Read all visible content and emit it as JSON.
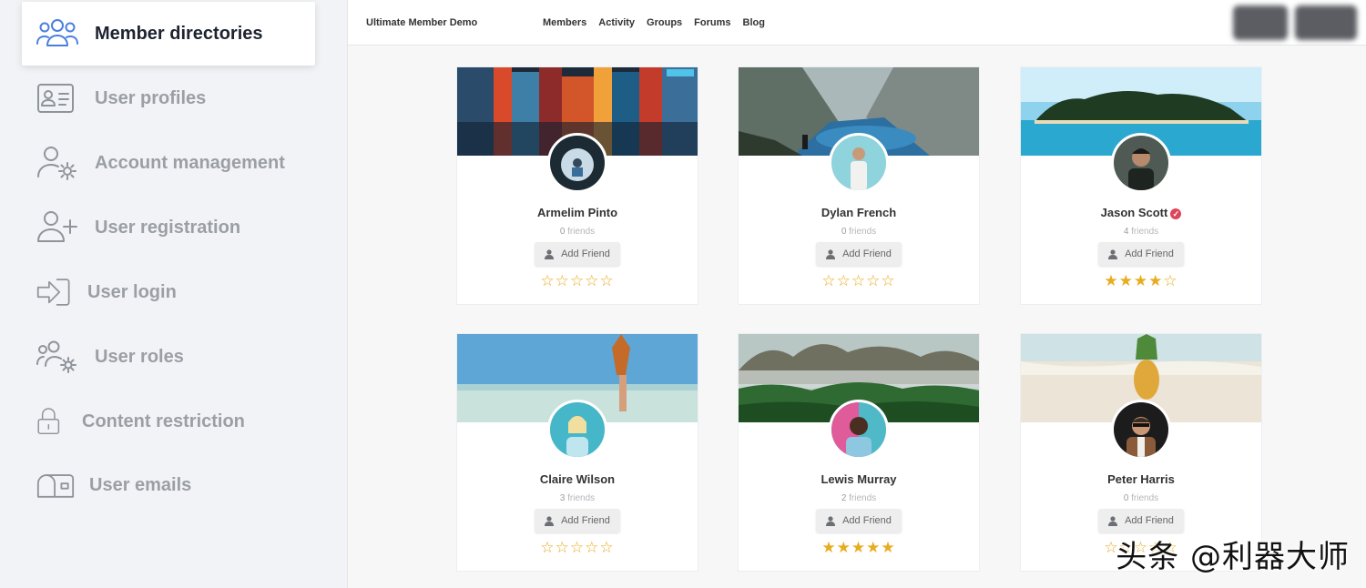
{
  "menu": {
    "items": [
      {
        "label": "Member directories",
        "icon": "users-icon",
        "active": true
      },
      {
        "label": "User profiles",
        "icon": "id-card-icon",
        "active": false
      },
      {
        "label": "Account management",
        "icon": "user-gear-icon",
        "active": false
      },
      {
        "label": "User registration",
        "icon": "user-plus-icon",
        "active": false
      },
      {
        "label": "User login",
        "icon": "login-arrow-icon",
        "active": false
      },
      {
        "label": "User roles",
        "icon": "users-gear-icon",
        "active": false
      },
      {
        "label": "Content restriction",
        "icon": "lock-icon",
        "active": false
      },
      {
        "label": "User emails",
        "icon": "mailbox-icon",
        "active": false
      }
    ],
    "accent_color": "#4a7fe0"
  },
  "site": {
    "brand": "Ultimate Member Demo",
    "nav": [
      "Members",
      "Activity",
      "Groups",
      "Forums",
      "Blog"
    ]
  },
  "members": [
    {
      "name": "Armelim Pinto",
      "friends_count": "0",
      "friends_label": "friends",
      "add_friend_label": "Add Friend",
      "rating": 0,
      "stars": "☆☆☆☆☆",
      "verified": false
    },
    {
      "name": "Dylan French",
      "friends_count": "0",
      "friends_label": "friends",
      "add_friend_label": "Add Friend",
      "rating": 0,
      "stars": "☆☆☆☆☆",
      "verified": false
    },
    {
      "name": "Jason Scott",
      "friends_count": "4",
      "friends_label": "friends",
      "add_friend_label": "Add Friend",
      "rating": 4,
      "stars": "★★★★☆",
      "verified": true
    },
    {
      "name": "Claire Wilson",
      "friends_count": "3",
      "friends_label": "friends",
      "add_friend_label": "Add Friend",
      "rating": 0,
      "stars": "☆☆☆☆☆",
      "verified": false
    },
    {
      "name": "Lewis Murray",
      "friends_count": "2",
      "friends_label": "friends",
      "add_friend_label": "Add Friend",
      "rating": 5,
      "stars": "★★★★★",
      "verified": false
    },
    {
      "name": "Peter Harris",
      "friends_count": "0",
      "friends_label": "friends",
      "add_friend_label": "Add Friend",
      "rating": 0,
      "stars": "☆☆☆☆☆",
      "verified": false
    }
  ],
  "star_color": "#e8ac1e",
  "verified_color": "#e0445a",
  "watermark": "头条 @利器大师"
}
